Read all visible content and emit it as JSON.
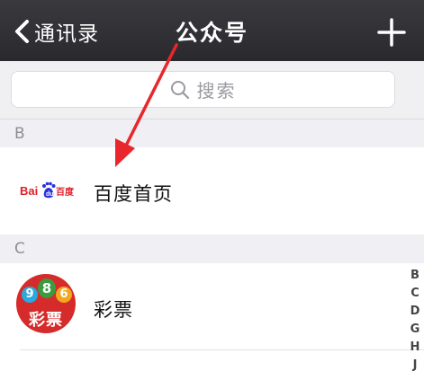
{
  "navbar": {
    "back_label": "通讯录",
    "title": "公众号",
    "add_icon": "plus-icon",
    "back_icon": "chevron-left-icon"
  },
  "search": {
    "placeholder": "搜索",
    "icon": "search-icon"
  },
  "sections": [
    {
      "letter": "B",
      "items": [
        {
          "name": "百度首页",
          "logo_text": "Bai百度",
          "icon": "baidu-logo"
        }
      ]
    },
    {
      "letter": "C",
      "items": [
        {
          "name": "彩票",
          "avatar_text": "彩票",
          "avatar_numbers": [
            "9",
            "8",
            "6"
          ],
          "icon": "lottery-avatar"
        }
      ]
    }
  ],
  "index_letters": [
    "B",
    "C",
    "D",
    "G",
    "H",
    "J"
  ],
  "colors": {
    "navbar": "#2f2f33",
    "background": "#efeff4",
    "annotation_arrow": "#e8262b",
    "baidu_red": "#de1e29",
    "baidu_blue": "#2932e1",
    "lottery_red": "#d62b2b"
  }
}
